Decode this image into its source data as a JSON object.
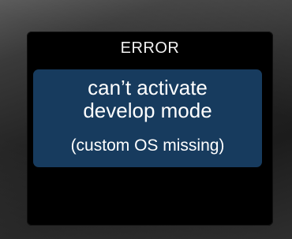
{
  "screen": {
    "title": "ERROR",
    "message": {
      "line1": "can’t activate",
      "line2": "develop mode",
      "detail": "(custom OS missing)"
    }
  },
  "colors": {
    "screen_background": "#000000",
    "message_box": "#173b5e",
    "text": "#ffffff"
  }
}
